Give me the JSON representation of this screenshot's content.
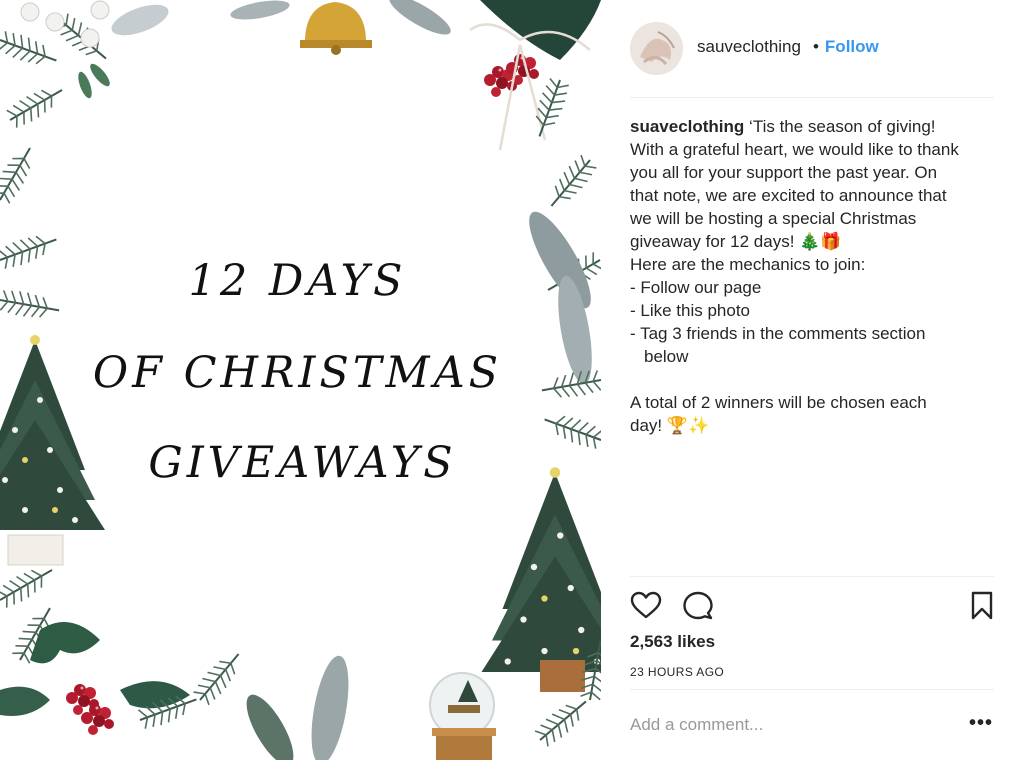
{
  "image": {
    "lines": [
      "12 DAYS",
      "OF CHRISTMAS",
      "GIVEAWAYS"
    ]
  },
  "header": {
    "username": "sauveclothing",
    "separator": "•",
    "follow_label": "Follow"
  },
  "caption": {
    "username": "suaveclothing",
    "lines": [
      "‘Tis the season of giving!",
      "With a grateful heart, we would like to thank",
      "you all for your support the past year. On",
      "that note, we are excited to announce that",
      "we will be hosting a special Christmas",
      "giveaway for 12 days! 🎄🎁",
      "Here are the mechanics to join:",
      "- Follow our page",
      "- Like this photo",
      "- Tag 3 friends in the comments section",
      "below",
      "A total of 2 winners will be chosen each",
      "day! 🏆✨"
    ]
  },
  "actions": {
    "like_icon": "heart-icon",
    "comment_icon": "comment-icon",
    "save_icon": "bookmark-icon"
  },
  "likes": "2,563 likes",
  "timestamp": "23 HOURS AGO",
  "comment_box": {
    "placeholder": "Add a comment...",
    "more_label": "•••"
  },
  "colors": {
    "follow": "#3897f0",
    "text": "#262626",
    "divider": "#efefef",
    "pine": "#2f4a3c",
    "berry": "#b01c2b",
    "gold": "#d4a437"
  }
}
